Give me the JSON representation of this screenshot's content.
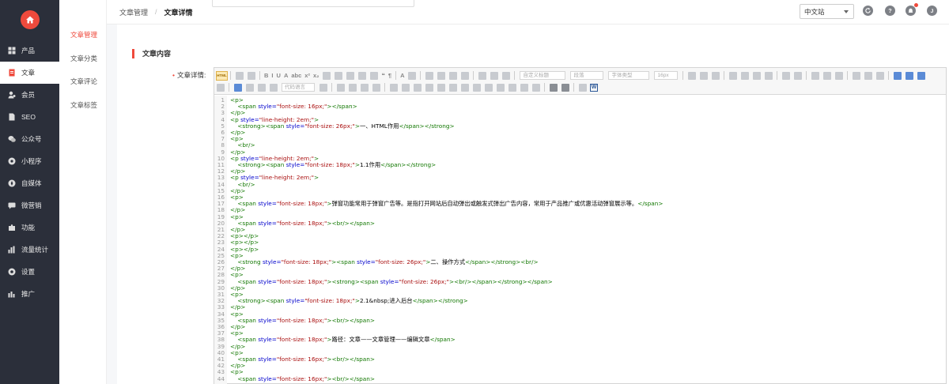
{
  "sidebar": {
    "logo_icon": "home-icon",
    "items": [
      {
        "label": "产品",
        "icon": "grid-icon",
        "active": false
      },
      {
        "label": "文章",
        "icon": "document-icon",
        "active": true
      },
      {
        "label": "会员",
        "icon": "user-icon",
        "active": false
      },
      {
        "label": "SEO",
        "icon": "file-icon",
        "active": false
      },
      {
        "label": "公众号",
        "icon": "wechat-icon",
        "active": false
      },
      {
        "label": "小程序",
        "icon": "miniapp-icon",
        "active": false
      },
      {
        "label": "自媒体",
        "icon": "compass-icon",
        "active": false
      },
      {
        "label": "微营销",
        "icon": "message-icon",
        "active": false
      },
      {
        "label": "功能",
        "icon": "puzzle-icon",
        "active": false
      },
      {
        "label": "流量统计",
        "icon": "bar-chart-icon",
        "active": false
      },
      {
        "label": "设置",
        "icon": "gear-icon",
        "active": false
      },
      {
        "label": "推广",
        "icon": "promote-icon",
        "active": false
      }
    ]
  },
  "submenu": {
    "items": [
      {
        "label": "文章管理",
        "active": true
      },
      {
        "label": "文章分类",
        "active": false
      },
      {
        "label": "文章评论",
        "active": false
      },
      {
        "label": "文章标签",
        "active": false
      }
    ]
  },
  "header": {
    "breadcrumb": [
      "文章管理",
      "文章详情"
    ],
    "site_select": "中文站",
    "icons": [
      "refresh-icon",
      "help-icon",
      "bell-icon",
      "user-avatar-icon"
    ]
  },
  "form": {
    "section_title": "文章内容",
    "field_label": "文章详情:",
    "toolbar": {
      "html_button": "HTML",
      "dropdowns": [
        "自定义标题",
        "段落",
        "字体类型",
        "16px"
      ],
      "code_lang": "代码语言"
    }
  },
  "code_lines": [
    {
      "n": "1",
      "parts": [
        [
          "tag",
          "<p>"
        ]
      ]
    },
    {
      "n": "2",
      "parts": [
        [
          "txt",
          "    "
        ],
        [
          "tag",
          "<span "
        ],
        [
          "attr",
          "style="
        ],
        [
          "val",
          "\"font-size: 16px;\""
        ],
        [
          "tag",
          "></span>"
        ]
      ]
    },
    {
      "n": "3",
      "parts": [
        [
          "tag",
          "</p>"
        ]
      ]
    },
    {
      "n": "4",
      "parts": [
        [
          "tag",
          "<p "
        ],
        [
          "attr",
          "style="
        ],
        [
          "val",
          "\"line-height: 2em;\""
        ],
        [
          "tag",
          ">"
        ]
      ]
    },
    {
      "n": "5",
      "parts": [
        [
          "txt",
          "    "
        ],
        [
          "tag",
          "<strong><span "
        ],
        [
          "attr",
          "style="
        ],
        [
          "val",
          "\"font-size: 26px;\""
        ],
        [
          "tag",
          ">"
        ],
        [
          "txt",
          "一、HTML作用"
        ],
        [
          "tag",
          "</span></strong>"
        ]
      ]
    },
    {
      "n": "6",
      "parts": [
        [
          "tag",
          "</p>"
        ]
      ]
    },
    {
      "n": "7",
      "parts": [
        [
          "tag",
          "<p>"
        ]
      ]
    },
    {
      "n": "8",
      "parts": [
        [
          "txt",
          "    "
        ],
        [
          "tag",
          "<br/>"
        ]
      ]
    },
    {
      "n": "9",
      "parts": [
        [
          "tag",
          "</p>"
        ]
      ]
    },
    {
      "n": "10",
      "parts": [
        [
          "tag",
          "<p "
        ],
        [
          "attr",
          "style="
        ],
        [
          "val",
          "\"line-height: 2em;\""
        ],
        [
          "tag",
          ">"
        ]
      ]
    },
    {
      "n": "11",
      "parts": [
        [
          "txt",
          "    "
        ],
        [
          "tag",
          "<strong><span "
        ],
        [
          "attr",
          "style="
        ],
        [
          "val",
          "\"font-size: 18px;\""
        ],
        [
          "tag",
          ">"
        ],
        [
          "txt",
          "1.1作用"
        ],
        [
          "tag",
          "</span></strong>"
        ]
      ]
    },
    {
      "n": "12",
      "parts": [
        [
          "tag",
          "</p>"
        ]
      ]
    },
    {
      "n": "13",
      "parts": [
        [
          "tag",
          "<p "
        ],
        [
          "attr",
          "style="
        ],
        [
          "val",
          "\"line-height: 2em;\""
        ],
        [
          "tag",
          ">"
        ]
      ]
    },
    {
      "n": "14",
      "parts": [
        [
          "txt",
          "    "
        ],
        [
          "tag",
          "<br/>"
        ]
      ]
    },
    {
      "n": "15",
      "parts": [
        [
          "tag",
          "</p>"
        ]
      ]
    },
    {
      "n": "16",
      "parts": [
        [
          "tag",
          "<p>"
        ]
      ]
    },
    {
      "n": "17",
      "parts": [
        [
          "txt",
          "    "
        ],
        [
          "tag",
          "<span "
        ],
        [
          "attr",
          "style="
        ],
        [
          "val",
          "\"font-size: 18px;\""
        ],
        [
          "tag",
          ">"
        ],
        [
          "txt",
          "弹窗功能常用于弹窗广告等。是指打开网站后自动弹出或触发式弹出广告内容，常用于产品推广或优惠活动弹窗展示等。"
        ],
        [
          "tag",
          "</span>"
        ]
      ]
    },
    {
      "n": "18",
      "parts": [
        [
          "tag",
          "</p>"
        ]
      ]
    },
    {
      "n": "19",
      "parts": [
        [
          "tag",
          "<p>"
        ]
      ]
    },
    {
      "n": "20",
      "parts": [
        [
          "txt",
          "    "
        ],
        [
          "tag",
          "<span "
        ],
        [
          "attr",
          "style="
        ],
        [
          "val",
          "\"font-size: 18px;\""
        ],
        [
          "tag",
          "><br/></span>"
        ]
      ]
    },
    {
      "n": "21",
      "parts": [
        [
          "tag",
          "</p>"
        ]
      ]
    },
    {
      "n": "22",
      "parts": [
        [
          "tag",
          "<p></p>"
        ]
      ]
    },
    {
      "n": "23",
      "parts": [
        [
          "tag",
          "<p></p>"
        ]
      ]
    },
    {
      "n": "24",
      "parts": [
        [
          "tag",
          "<p></p>"
        ]
      ]
    },
    {
      "n": "25",
      "parts": [
        [
          "tag",
          "<p>"
        ]
      ]
    },
    {
      "n": "26",
      "parts": [
        [
          "txt",
          "    "
        ],
        [
          "tag",
          "<strong "
        ],
        [
          "attr",
          "style="
        ],
        [
          "val",
          "\"font-size: 18px;\""
        ],
        [
          "tag",
          "><span "
        ],
        [
          "attr",
          "style="
        ],
        [
          "val",
          "\"font-size: 26px;\""
        ],
        [
          "tag",
          ">"
        ],
        [
          "txt",
          "二、操作方式"
        ],
        [
          "tag",
          "</span></strong><br/>"
        ]
      ]
    },
    {
      "n": "27",
      "parts": [
        [
          "tag",
          "</p>"
        ]
      ]
    },
    {
      "n": "28",
      "parts": [
        [
          "tag",
          "<p>"
        ]
      ]
    },
    {
      "n": "29",
      "parts": [
        [
          "txt",
          "    "
        ],
        [
          "tag",
          "<span "
        ],
        [
          "attr",
          "style="
        ],
        [
          "val",
          "\"font-size: 18px;\""
        ],
        [
          "tag",
          "><strong><span "
        ],
        [
          "attr",
          "style="
        ],
        [
          "val",
          "\"font-size: 26px;\""
        ],
        [
          "tag",
          "><br/></span></strong></span>"
        ]
      ]
    },
    {
      "n": "30",
      "parts": [
        [
          "tag",
          "</p>"
        ]
      ]
    },
    {
      "n": "31",
      "parts": [
        [
          "tag",
          "<p>"
        ]
      ]
    },
    {
      "n": "32",
      "parts": [
        [
          "txt",
          "    "
        ],
        [
          "tag",
          "<strong><span "
        ],
        [
          "attr",
          "style="
        ],
        [
          "val",
          "\"font-size: 18px;\""
        ],
        [
          "tag",
          ">"
        ],
        [
          "txt",
          "2.1&nbsp;进入后台"
        ],
        [
          "tag",
          "</span></strong>"
        ]
      ]
    },
    {
      "n": "33",
      "parts": [
        [
          "tag",
          "</p>"
        ]
      ]
    },
    {
      "n": "34",
      "parts": [
        [
          "tag",
          "<p>"
        ]
      ]
    },
    {
      "n": "35",
      "parts": [
        [
          "txt",
          "    "
        ],
        [
          "tag",
          "<span "
        ],
        [
          "attr",
          "style="
        ],
        [
          "val",
          "\"font-size: 18px;\""
        ],
        [
          "tag",
          "><br/></span>"
        ]
      ]
    },
    {
      "n": "36",
      "parts": [
        [
          "tag",
          "</p>"
        ]
      ]
    },
    {
      "n": "37",
      "parts": [
        [
          "tag",
          "<p>"
        ]
      ]
    },
    {
      "n": "38",
      "parts": [
        [
          "txt",
          "    "
        ],
        [
          "tag",
          "<span "
        ],
        [
          "attr",
          "style="
        ],
        [
          "val",
          "\"font-size: 18px;\""
        ],
        [
          "tag",
          ">"
        ],
        [
          "txt",
          "路径：文章——文章管理——编辑文章"
        ],
        [
          "tag",
          "</span>"
        ]
      ]
    },
    {
      "n": "39",
      "parts": [
        [
          "tag",
          "</p>"
        ]
      ]
    },
    {
      "n": "40",
      "parts": [
        [
          "tag",
          "<p>"
        ]
      ]
    },
    {
      "n": "41",
      "parts": [
        [
          "txt",
          "    "
        ],
        [
          "tag",
          "<span "
        ],
        [
          "attr",
          "style="
        ],
        [
          "val",
          "\"font-size: 16px;\""
        ],
        [
          "tag",
          "><br/></span>"
        ]
      ]
    },
    {
      "n": "42",
      "parts": [
        [
          "tag",
          "</p>"
        ]
      ]
    },
    {
      "n": "43",
      "parts": [
        [
          "tag",
          "<p>"
        ]
      ]
    },
    {
      "n": "44",
      "parts": [
        [
          "txt",
          "    "
        ],
        [
          "tag",
          "<span "
        ],
        [
          "attr",
          "style="
        ],
        [
          "val",
          "\"font-size: 16px;\""
        ],
        [
          "tag",
          "><br/></span>"
        ]
      ]
    }
  ]
}
